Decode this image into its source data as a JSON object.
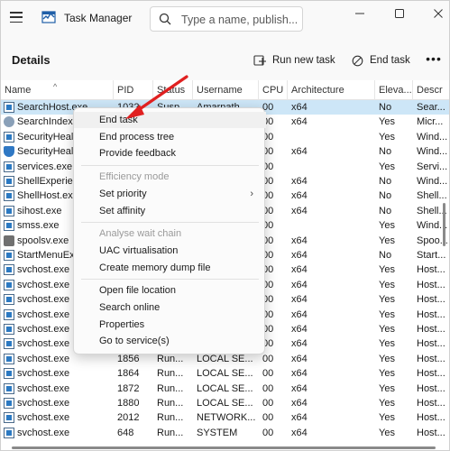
{
  "window": {
    "title": "Task Manager",
    "search_placeholder": "Type a name, publish...",
    "controls": [
      "minimize-icon",
      "maximize-icon",
      "close-icon"
    ]
  },
  "toolbar": {
    "page_title": "Details",
    "run_new_task_label": "Run new task",
    "end_task_label": "End task",
    "more_label": "•••"
  },
  "table": {
    "columns": [
      "Name",
      "PID",
      "Status",
      "Username",
      "CPU",
      "Architecture",
      "Eleva...",
      "Descr"
    ],
    "rows": [
      {
        "name": "SearchHost.exe",
        "pid": "1032",
        "status": "Susp...",
        "user": "Amarnath",
        "cpu": "00",
        "arch": "x64",
        "elev": "No",
        "desc": "Sear...",
        "icon": "app",
        "selected": true
      },
      {
        "name": "SearchIndexer...",
        "pid": "",
        "status": "",
        "user": "",
        "cpu": "00",
        "arch": "x64",
        "elev": "Yes",
        "desc": "Micr...",
        "icon": "user"
      },
      {
        "name": "SecurityHealt...",
        "pid": "",
        "status": "",
        "user": "",
        "cpu": "00",
        "arch": "",
        "elev": "Yes",
        "desc": "Wind...",
        "icon": "app"
      },
      {
        "name": "SecurityHealt...",
        "pid": "",
        "status": "",
        "user": "",
        "cpu": "00",
        "arch": "x64",
        "elev": "No",
        "desc": "Wind...",
        "icon": "shield"
      },
      {
        "name": "services.exe",
        "pid": "",
        "status": "",
        "user": "",
        "cpu": "00",
        "arch": "",
        "elev": "Yes",
        "desc": "Servi...",
        "icon": "app"
      },
      {
        "name": "ShellExperien...",
        "pid": "",
        "status": "",
        "user": "",
        "cpu": "00",
        "arch": "x64",
        "elev": "No",
        "desc": "Wind...",
        "icon": "app"
      },
      {
        "name": "ShellHost.exe",
        "pid": "",
        "status": "",
        "user": "",
        "cpu": "00",
        "arch": "x64",
        "elev": "No",
        "desc": "Shell...",
        "icon": "app"
      },
      {
        "name": "sihost.exe",
        "pid": "",
        "status": "",
        "user": "",
        "cpu": "00",
        "arch": "x64",
        "elev": "No",
        "desc": "Shell...",
        "icon": "app"
      },
      {
        "name": "smss.exe",
        "pid": "",
        "status": "",
        "user": "",
        "cpu": "00",
        "arch": "",
        "elev": "Yes",
        "desc": "Wind...",
        "icon": "app"
      },
      {
        "name": "spoolsv.exe",
        "pid": "",
        "status": "",
        "user": "",
        "cpu": "00",
        "arch": "x64",
        "elev": "Yes",
        "desc": "Spoo...",
        "icon": "printer"
      },
      {
        "name": "StartMenuExp...",
        "pid": "",
        "status": "",
        "user": "",
        "cpu": "00",
        "arch": "x64",
        "elev": "No",
        "desc": "Start...",
        "icon": "app"
      },
      {
        "name": "svchost.exe",
        "pid": "",
        "status": "",
        "user": "",
        "cpu": "00",
        "arch": "x64",
        "elev": "Yes",
        "desc": "Host...",
        "icon": "app"
      },
      {
        "name": "svchost.exe",
        "pid": "",
        "status": "",
        "user": "",
        "cpu": "00",
        "arch": "x64",
        "elev": "Yes",
        "desc": "Host...",
        "icon": "app"
      },
      {
        "name": "svchost.exe",
        "pid": "",
        "status": "",
        "user": "",
        "cpu": "00",
        "arch": "x64",
        "elev": "Yes",
        "desc": "Host...",
        "icon": "app"
      },
      {
        "name": "svchost.exe",
        "pid": "",
        "status": "",
        "user": "",
        "cpu": "00",
        "arch": "x64",
        "elev": "Yes",
        "desc": "Host...",
        "icon": "app"
      },
      {
        "name": "svchost.exe",
        "pid": "",
        "status": "",
        "user": "",
        "cpu": "00",
        "arch": "x64",
        "elev": "Yes",
        "desc": "Host...",
        "icon": "app"
      },
      {
        "name": "svchost.exe",
        "pid": "",
        "status": "",
        "user": "",
        "cpu": "00",
        "arch": "x64",
        "elev": "Yes",
        "desc": "Host...",
        "icon": "app"
      },
      {
        "name": "svchost.exe",
        "pid": "1856",
        "status": "Run...",
        "user": "LOCAL SE...",
        "cpu": "00",
        "arch": "x64",
        "elev": "Yes",
        "desc": "Host...",
        "icon": "app"
      },
      {
        "name": "svchost.exe",
        "pid": "1864",
        "status": "Run...",
        "user": "LOCAL SE...",
        "cpu": "00",
        "arch": "x64",
        "elev": "Yes",
        "desc": "Host...",
        "icon": "app"
      },
      {
        "name": "svchost.exe",
        "pid": "1872",
        "status": "Run...",
        "user": "LOCAL SE...",
        "cpu": "00",
        "arch": "x64",
        "elev": "Yes",
        "desc": "Host...",
        "icon": "app"
      },
      {
        "name": "svchost.exe",
        "pid": "1880",
        "status": "Run...",
        "user": "LOCAL SE...",
        "cpu": "00",
        "arch": "x64",
        "elev": "Yes",
        "desc": "Host...",
        "icon": "app"
      },
      {
        "name": "svchost.exe",
        "pid": "2012",
        "status": "Run...",
        "user": "NETWORK...",
        "cpu": "00",
        "arch": "x64",
        "elev": "Yes",
        "desc": "Host...",
        "icon": "app"
      },
      {
        "name": "svchost.exe",
        "pid": "648",
        "status": "Run...",
        "user": "SYSTEM",
        "cpu": "00",
        "arch": "x64",
        "elev": "Yes",
        "desc": "Host...",
        "icon": "app"
      }
    ]
  },
  "context_menu": {
    "groups": [
      [
        {
          "label": "End task",
          "enabled": true,
          "hover": true
        },
        {
          "label": "End process tree",
          "enabled": true
        },
        {
          "label": "Provide feedback",
          "enabled": true
        }
      ],
      [
        {
          "label": "Efficiency mode",
          "enabled": false
        },
        {
          "label": "Set priority",
          "enabled": true,
          "submenu": true
        },
        {
          "label": "Set affinity",
          "enabled": true
        }
      ],
      [
        {
          "label": "Analyse wait chain",
          "enabled": false
        },
        {
          "label": "UAC virtualisation",
          "enabled": true
        },
        {
          "label": "Create memory dump file",
          "enabled": true
        }
      ],
      [
        {
          "label": "Open file location",
          "enabled": true
        },
        {
          "label": "Search online",
          "enabled": true
        },
        {
          "label": "Properties",
          "enabled": true
        },
        {
          "label": "Go to service(s)",
          "enabled": true
        }
      ]
    ]
  },
  "colors": {
    "selected_row": "#cde6f7",
    "annotation_arrow": "#e02020",
    "accent": "#2b79c2"
  }
}
